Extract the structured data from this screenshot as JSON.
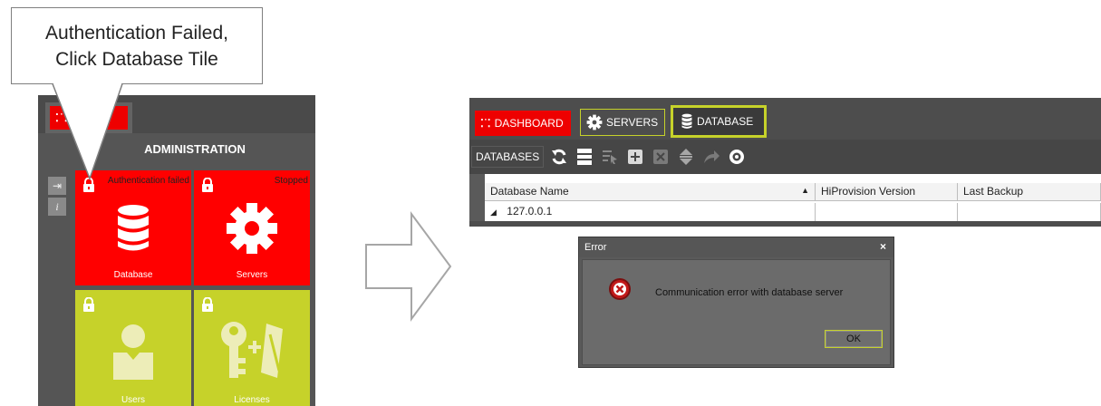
{
  "callout": {
    "line1": "Authentication Failed,",
    "line2": "Click Database Tile"
  },
  "admin_panel": {
    "tab_label": "RD",
    "title": "ADMINISTRATION",
    "side_buttons": [
      {
        "icon": "logout-icon",
        "glyph": "⇥"
      },
      {
        "icon": "info-icon",
        "glyph": "i"
      }
    ],
    "tiles": [
      {
        "label": "Database",
        "status": "Authentication failed",
        "color": "#ff0000",
        "icon": "database-icon"
      },
      {
        "label": "Servers",
        "status": "Stopped",
        "color": "#ff0000",
        "icon": "gear-icon"
      },
      {
        "label": "Users",
        "status": "",
        "color": "#c6d22a",
        "icon": "user-icon"
      },
      {
        "label": "Licenses",
        "status": "",
        "color": "#c6d22a",
        "icon": "license-key-icon"
      }
    ]
  },
  "app_window": {
    "tabs": [
      {
        "label": "DASHBOARD",
        "icon": "dashboard-dots-icon",
        "active": false
      },
      {
        "label": "SERVERS",
        "icon": "gear-icon",
        "active": false
      },
      {
        "label": "DATABASE",
        "icon": "database-icon",
        "active": true
      }
    ],
    "toolbar": {
      "label": "DATABASES",
      "buttons": [
        "refresh-icon",
        "list-icon",
        "select-icon",
        "add-icon",
        "delete-icon",
        "expand-icon",
        "export-icon",
        "settings-icon"
      ]
    },
    "grid": {
      "columns": [
        "Database Name",
        "HiProvision Version",
        "Last Backup"
      ],
      "rows": [
        {
          "name": "127.0.0.1",
          "version": "",
          "last_backup": ""
        }
      ]
    }
  },
  "error_dialog": {
    "title": "Error",
    "close": "×",
    "message": "Communication error with database server",
    "ok_label": "OK"
  },
  "colors": {
    "red": "#ff0000",
    "lime": "#c6d22a",
    "dark_gray": "#4d4d4d"
  }
}
